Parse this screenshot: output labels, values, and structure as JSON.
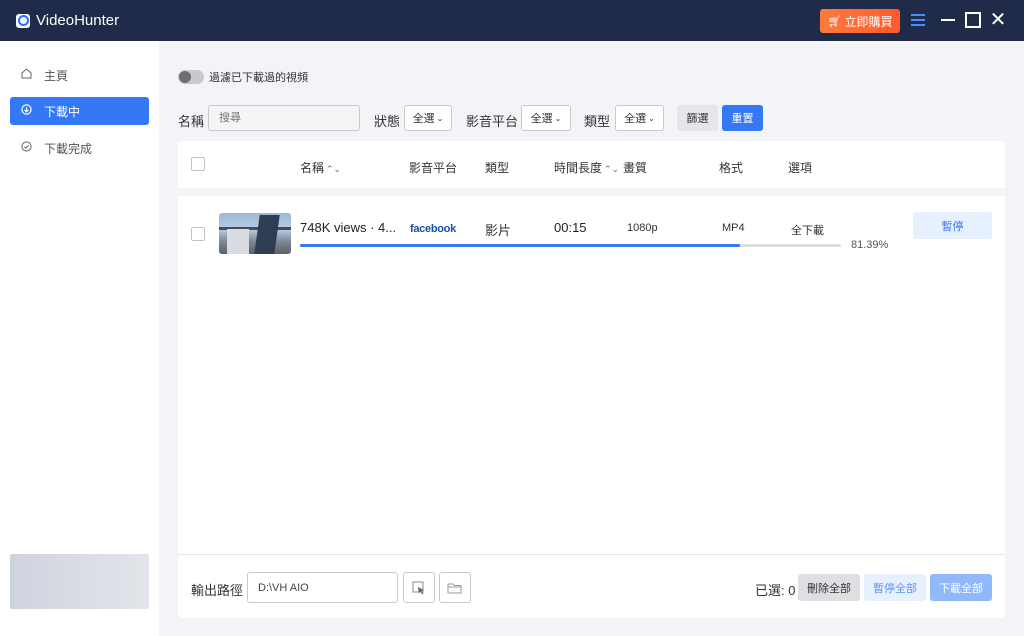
{
  "titlebar": {
    "app_title": "VideoHunter",
    "buy_label": "立即購買",
    "accent_color": "#ff6633"
  },
  "sidebar": {
    "items": [
      {
        "label": "主頁",
        "icon": "home-icon",
        "active": false
      },
      {
        "label": "下載中",
        "icon": "download-icon",
        "active": true
      },
      {
        "label": "下載完成",
        "icon": "check-circle-icon",
        "active": false
      }
    ]
  },
  "main": {
    "toggle_label": "過濾已下載過的視頻",
    "toggle_on": false,
    "filters": {
      "name_label": "名稱",
      "search_placeholder": "搜尋",
      "status_label": "狀態",
      "status_value": "全選",
      "platform_label": "影音平台",
      "platform_value": "全選",
      "type_label": "類型",
      "type_value": "全選",
      "filter_button": "篩選",
      "reset_button": "重置"
    },
    "table": {
      "headers": {
        "name": "名稱",
        "platform": "影音平台",
        "type": "類型",
        "duration": "時間長度",
        "quality": "畫質",
        "format": "格式",
        "options": "選項"
      },
      "rows": [
        {
          "title": "748K views · 4...",
          "platform": "facebook",
          "type": "影片",
          "duration": "00:15",
          "quality": "1080p",
          "format": "MP4",
          "option": "全下載",
          "progress_percent": 81.39,
          "progress_label": "81.39%",
          "action": "暫停"
        }
      ]
    },
    "footer": {
      "output_label": "輸出路徑",
      "output_path": "D:\\VH AIO",
      "selected_label": "已選:",
      "selected_count": "0",
      "delete_all": "刪除全部",
      "pause_all": "暫停全部",
      "download_all": "下載全部"
    }
  }
}
